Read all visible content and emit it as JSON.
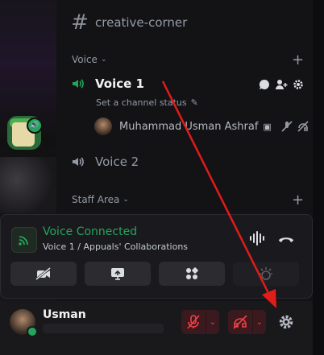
{
  "channels": {
    "text_channel": "creative-corner",
    "voice_category": "Voice",
    "voice1": {
      "name": "Voice 1",
      "status_placeholder": "Set a channel status",
      "member": "Muhammad Usman Ashraf"
    },
    "voice2": {
      "name": "Voice 2"
    },
    "staff_category": "Staff Area"
  },
  "voice_connected": {
    "title": "Voice Connected",
    "subtitle": "Voice 1 / Appuals' Collaborations"
  },
  "user": {
    "name": "Usman"
  },
  "colors": {
    "connected_green": "#23a55a",
    "muted_red": "#f23f43",
    "annotation_arrow": "#e21b1b"
  }
}
